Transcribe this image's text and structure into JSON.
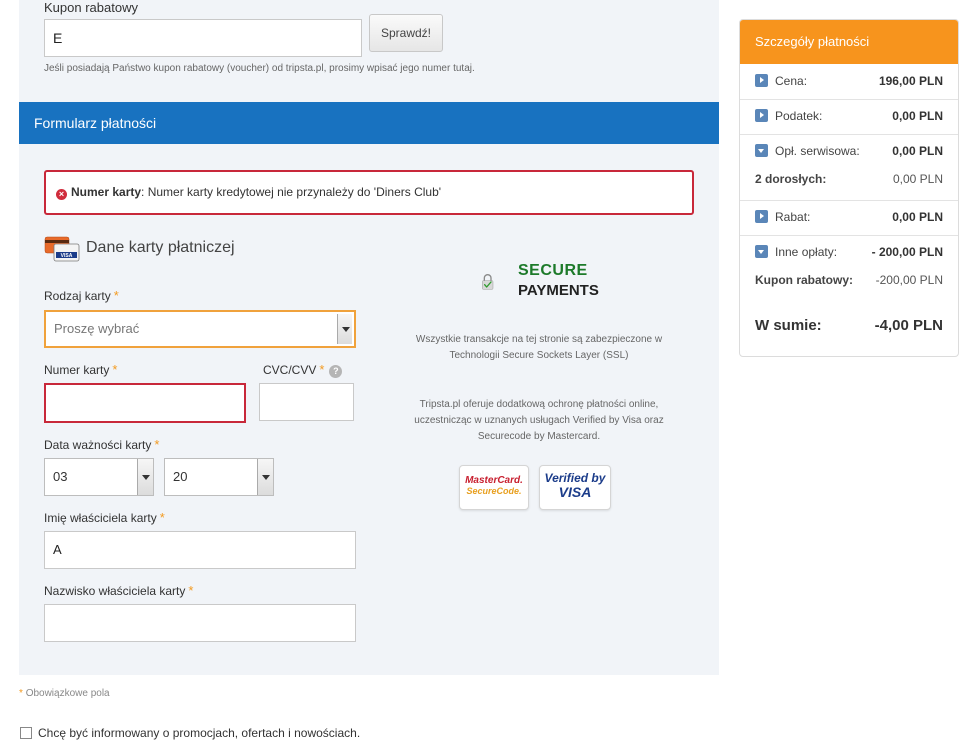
{
  "coupon": {
    "label": "Kupon rabatowy",
    "value": "E",
    "button": "Sprawdź!",
    "hint": "Jeśli posiadają Państwo kupon rabatowy (voucher) od tripsta.pl, prosimy wpisać jego numer tutaj."
  },
  "form": {
    "header": "Formularz płatności",
    "error": {
      "field": "Numer karty",
      "message": ": Numer karty kredytowej nie przynależy do 'Diners Club'"
    },
    "card_section_title": "Dane karty płatniczej",
    "card_icon_text": "VISA",
    "card_type": {
      "label": "Rodzaj karty",
      "selected": "Proszę wybrać"
    },
    "card_number": {
      "label": "Numer karty",
      "value": ""
    },
    "cvc": {
      "label": "CVC/CVV",
      "value": "",
      "help": "?"
    },
    "expiry": {
      "label": "Data ważności karty",
      "month": "03",
      "year": "20"
    },
    "first_name": {
      "label": "Imię właściciela karty",
      "value": "A"
    },
    "last_name": {
      "label": "Nazwisko właściciela karty",
      "value": ""
    },
    "required_star": "*"
  },
  "secure": {
    "title1": "SECURE",
    "title2": "PAYMENTS",
    "desc1": "Wszystkie transakcje na tej stronie są zabezpieczone w Technologii Secure Sockets Layer (SSL)",
    "desc2": "Tripsta.pl oferuje dodatkową ochronę płatności online, uczestnicząc w uznanych usługach Verified by Visa oraz Securecode by Mastercard.",
    "mastercard_line1": "MasterCard.",
    "mastercard_line2": "SecureCode.",
    "visa_line1": "Verified by",
    "visa_line2": "VISA"
  },
  "footer": {
    "required_note": "Obowiązkowe pola",
    "newsletter": "Chcę być informowany o promocjach, ofertach i nowościach."
  },
  "summary": {
    "title": "Szczegóły płatności",
    "price": {
      "label": "Cena:",
      "value": "196,00 PLN"
    },
    "tax": {
      "label": "Podatek:",
      "value": "0,00 PLN"
    },
    "service_fee": {
      "label": "Opł. serwisowa:",
      "value": "0,00 PLN"
    },
    "adults": {
      "label": "2 dorosłych:",
      "value": "0,00 PLN"
    },
    "discount": {
      "label": "Rabat:",
      "value": "0,00 PLN"
    },
    "other_fees": {
      "label": "Inne opłaty:",
      "value": "- 200,00 PLN"
    },
    "coupon": {
      "label": "Kupon rabatowy:",
      "value": "-200,00 PLN"
    },
    "total": {
      "label": "W sumie:",
      "value": "-4,00 PLN"
    }
  },
  "colors": {
    "header_blue": "#1872c0",
    "summary_orange": "#f7941d",
    "error_red": "#c8283a",
    "required_orange": "#f39a1f",
    "secure_green": "#1d7a2a"
  }
}
